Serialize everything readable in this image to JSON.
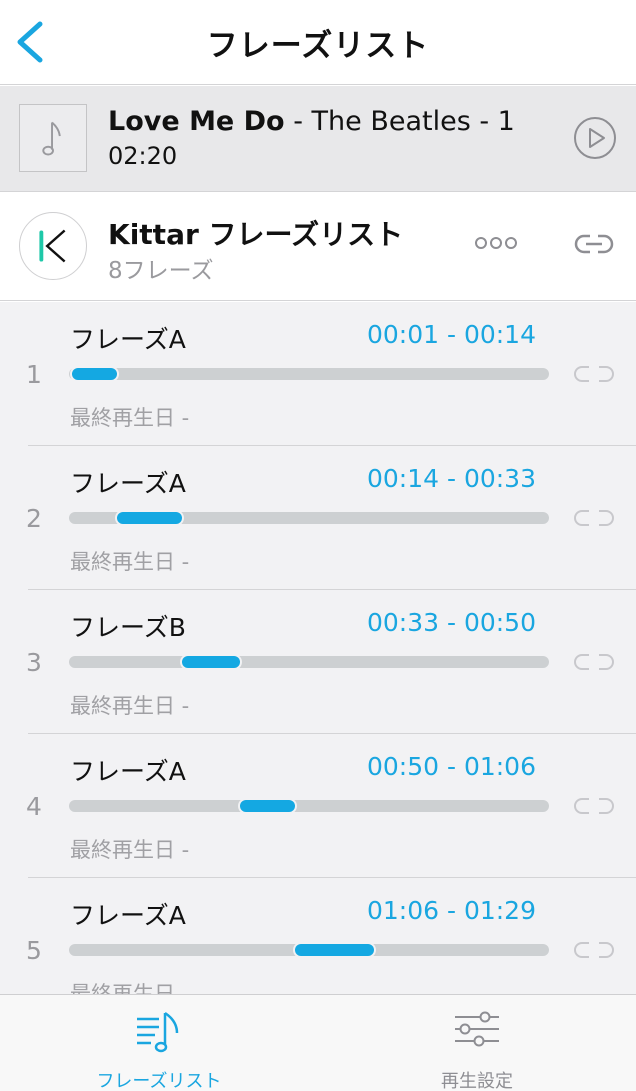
{
  "header": {
    "title": "フレーズリスト",
    "back_icon": "chevron-left-icon"
  },
  "song": {
    "name": "Love Me Do",
    "rest": " - The Beatles - 1",
    "duration": "02:20",
    "art_icon": "music-note-icon",
    "play_icon": "play-circle-icon"
  },
  "playlist": {
    "title": "Kittar フレーズリスト",
    "count": "8フレーズ",
    "more_icon": "more-icon",
    "link_icon": "link-icon"
  },
  "phrases": [
    {
      "num": "1",
      "name": "フレーズA",
      "time": "00:01 - 00:14",
      "last_played": "最終再生日 -",
      "start_frac": 0.007,
      "end_frac": 0.1
    },
    {
      "num": "2",
      "name": "フレーズA",
      "time": "00:14 - 00:33",
      "last_played": "最終再生日 -",
      "start_frac": 0.1,
      "end_frac": 0.236
    },
    {
      "num": "3",
      "name": "フレーズB",
      "time": "00:33 - 00:50",
      "last_played": "最終再生日 -",
      "start_frac": 0.236,
      "end_frac": 0.357
    },
    {
      "num": "4",
      "name": "フレーズA",
      "time": "00:50 - 01:06",
      "last_played": "最終再生日 -",
      "start_frac": 0.357,
      "end_frac": 0.471
    },
    {
      "num": "5",
      "name": "フレーズA",
      "time": "01:06 - 01:29",
      "last_played": "最終再生日 -",
      "start_frac": 0.471,
      "end_frac": 0.636
    }
  ],
  "tabbar": [
    {
      "label": "フレーズリスト",
      "icon": "phrase-list-icon",
      "active": true
    },
    {
      "label": "再生設定",
      "icon": "sliders-icon",
      "active": false
    }
  ],
  "colors": {
    "accent": "#1aa6e0",
    "inactive": "#8e8e93",
    "track": "#cdd0d2"
  }
}
